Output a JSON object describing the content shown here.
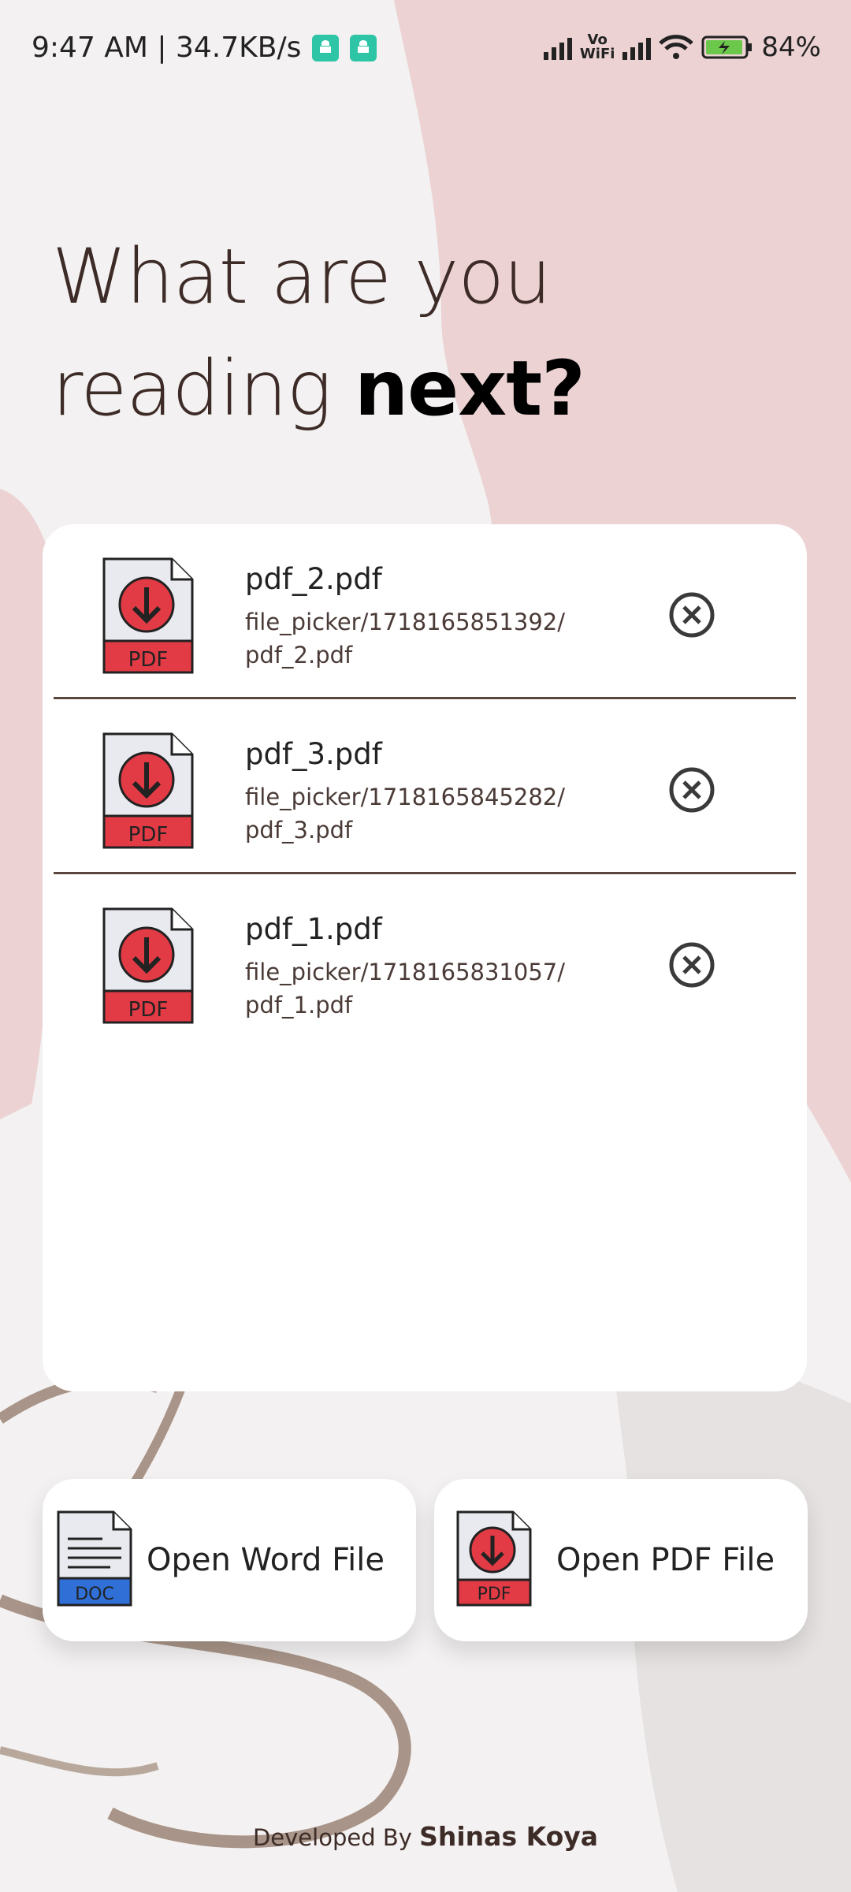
{
  "status_bar": {
    "time_speed": "9:47 AM | 34.7KB/s",
    "vowifi_top": "Vo",
    "vowifi_bottom": "WiFi",
    "battery": "84%"
  },
  "headline": {
    "line1": "What are you",
    "line2_regular": "reading ",
    "line2_bold": "next?"
  },
  "files": [
    {
      "name": "pdf_2.pdf",
      "path_line1": "file_picker/1718165851392/",
      "path_line2": "pdf_2.pdf"
    },
    {
      "name": "pdf_3.pdf",
      "path_line1": "file_picker/1718165845282/",
      "path_line2": "pdf_3.pdf"
    },
    {
      "name": "pdf_1.pdf",
      "path_line1": "file_picker/1718165831057/",
      "path_line2": "pdf_1.pdf"
    }
  ],
  "icons": {
    "pdf_label": "PDF",
    "doc_label": "DOC",
    "remove": "close-circle-icon"
  },
  "buttons": {
    "open_word": "Open Word File",
    "open_pdf": "Open PDF File"
  },
  "footer": {
    "prefix": "Developed By ",
    "author": "Shinas Koya"
  },
  "colors": {
    "accent_red": "#e23b45",
    "doc_blue": "#2f6fd6",
    "text_brown": "#3d2b27"
  }
}
